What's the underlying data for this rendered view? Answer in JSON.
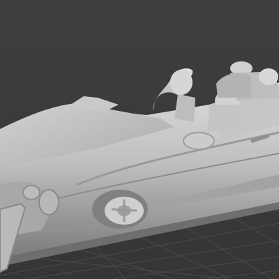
{
  "scene": {
    "viewport_label": "",
    "model_name": "convertible-car-3d-scan",
    "colors": {
      "background": "#3b3b3b",
      "grid_line": "#4b4b4b",
      "model_light": "#d4d4d4",
      "model_mid": "#b0b0b0",
      "model_dark": "#7c7c7c",
      "build_plate": "#9a9a9a"
    }
  }
}
